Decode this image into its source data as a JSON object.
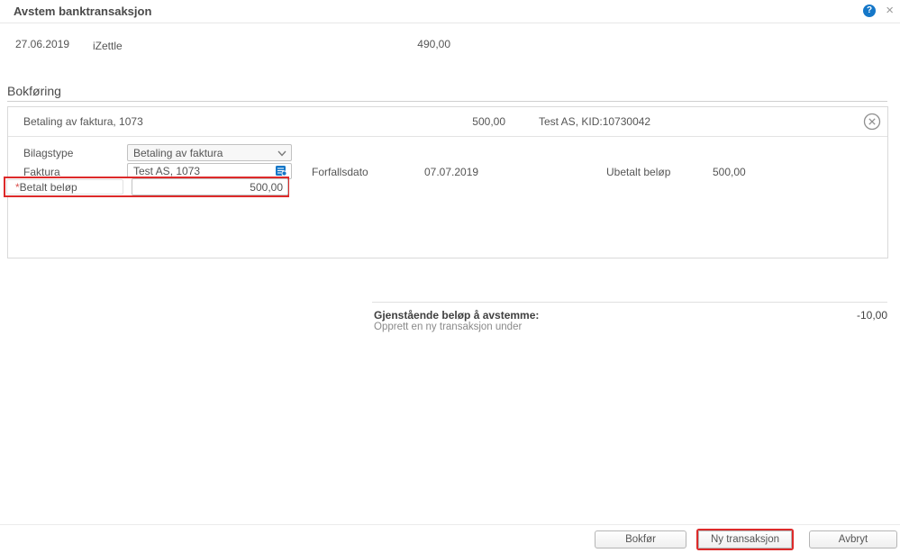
{
  "header": {
    "title": "Avstem banktransaksjon",
    "help_icon": "?",
    "close_icon": "×"
  },
  "transaction": {
    "date": "27.06.2019",
    "description": "iZettle",
    "amount": "490,00"
  },
  "bokforing": {
    "section_title": "Bokføring",
    "entry": {
      "title": "Betaling av faktura, 1073",
      "amount": "500,00",
      "details": "Test AS, KID:10730042"
    },
    "form": {
      "bilagstype_label": "Bilagstype",
      "bilagstype_value": "Betaling av faktura",
      "faktura_label": "Faktura",
      "faktura_value": "Test AS, 1073",
      "forfallsdato_label": "Forfallsdato",
      "forfallsdato_value": "07.07.2019",
      "ubetalt_label": "Ubetalt beløp",
      "ubetalt_value": "500,00",
      "betalt_required_mark": "*",
      "betalt_label": "Betalt beløp",
      "betalt_value": "500,00"
    }
  },
  "summary": {
    "remaining_label": "Gjenstående beløp å avstemme:",
    "remaining_value": "-10,00",
    "hint": "Opprett en ny transaksjon under"
  },
  "footer": {
    "bokfor_label": "Bokfør",
    "ny_transaksjon_label": "Ny transaksjon",
    "avbryt_label": "Avbryt"
  },
  "colors": {
    "accent_blue": "#1577c8",
    "annotation_red": "#dd2a2a"
  }
}
